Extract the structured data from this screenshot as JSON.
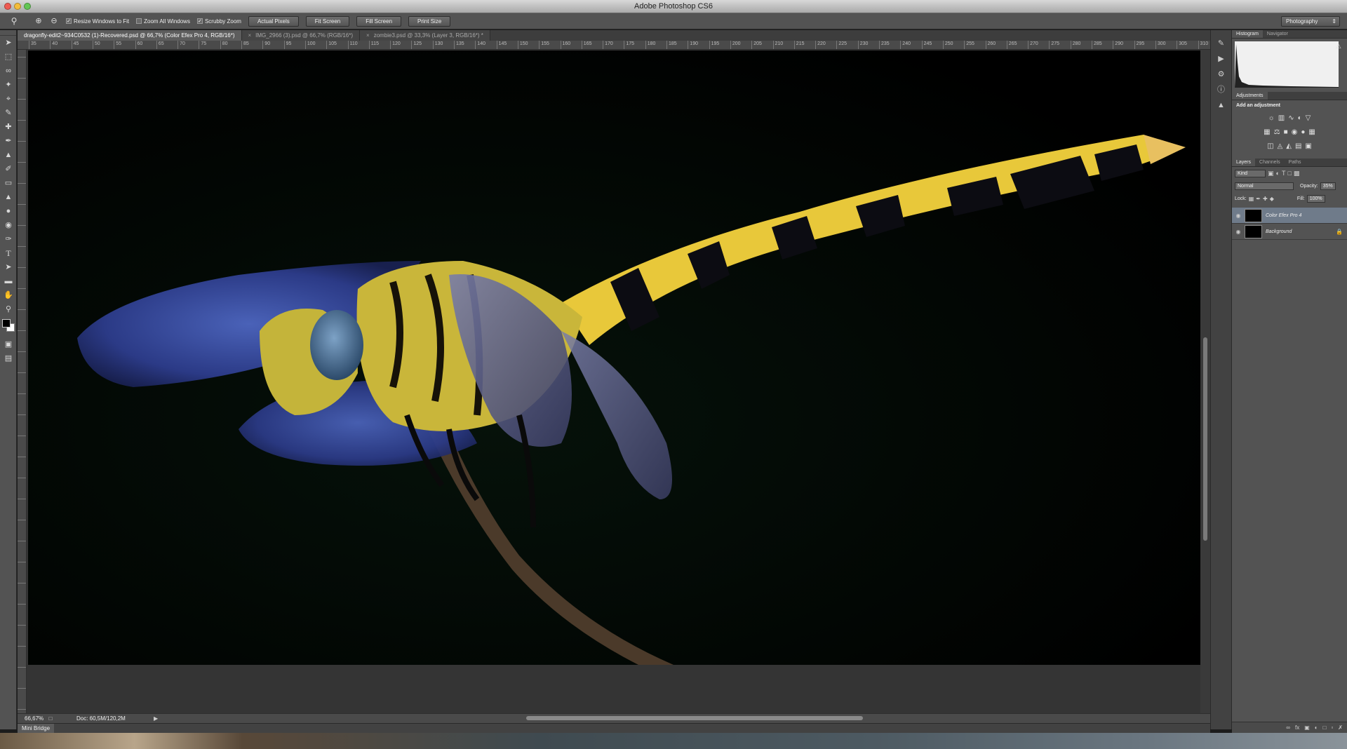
{
  "app": {
    "title": "Adobe Photoshop CS6"
  },
  "options": {
    "zoom_tool_icon": "zoom-icon",
    "zoom_in_icon": "zoom-in-icon",
    "zoom_out_icon": "zoom-out-icon",
    "resize_windows": {
      "label": "Resize Windows to Fit",
      "checked": true
    },
    "zoom_all": {
      "label": "Zoom All Windows",
      "checked": false
    },
    "scrubby_zoom": {
      "label": "Scrubby Zoom",
      "checked": true
    },
    "actual_pixels": "Actual Pixels",
    "fit_screen": "Fit Screen",
    "fill_screen": "Fill Screen",
    "print_size": "Print Size",
    "workspace": "Photography"
  },
  "tabs": [
    {
      "label": "dragonfly-edit2~934C0532 (1)-Recovered.psd @ 66,7% (Color Efex Pro 4, RGB/16*)",
      "active": true
    },
    {
      "label": "IMG_2966 (3).psd @ 66,7% (RGB/16*)",
      "active": false
    },
    {
      "label": "zombie3.psd @ 33,3% (Layer 3, RGB/16*) *",
      "active": false
    }
  ],
  "ruler": {
    "labels": [
      "35",
      "40",
      "45",
      "50",
      "55",
      "60",
      "65",
      "70",
      "75",
      "80",
      "85",
      "90",
      "95",
      "100",
      "105",
      "110",
      "115",
      "120",
      "125",
      "130",
      "135",
      "140",
      "145",
      "150",
      "155",
      "160",
      "165",
      "170",
      "175",
      "180",
      "185",
      "190",
      "195",
      "200",
      "205",
      "210",
      "215",
      "220",
      "225",
      "230",
      "235",
      "240",
      "245",
      "250",
      "255",
      "260",
      "265",
      "270",
      "275",
      "280",
      "285",
      "290",
      "295",
      "300",
      "305",
      "310"
    ]
  },
  "status": {
    "zoom": "66,67%",
    "doc": "Doc: 60,5M/120,2M"
  },
  "mini_bridge": "Mini Bridge",
  "panels": {
    "histogram_tab": "Histogram",
    "navigator_tab": "Navigator",
    "adjustments_tab": "Adjustments",
    "add_adjustment": "Add an adjustment",
    "layers_tab": "Layers",
    "channels_tab": "Channels",
    "paths_tab": "Paths",
    "kind": "Kind",
    "blend_mode": "Normal",
    "opacity_label": "Opacity:",
    "opacity_value": "35%",
    "lock_label": "Lock:",
    "fill_label": "Fill:",
    "fill_value": "100%",
    "layers": [
      {
        "name": "Color Efex Pro 4",
        "selected": true,
        "locked": false
      },
      {
        "name": "Background",
        "selected": false,
        "locked": true
      }
    ]
  },
  "colors": {
    "foreground": "#000000",
    "background": "#ffffff",
    "accent_selected": "#6f7b8a"
  }
}
